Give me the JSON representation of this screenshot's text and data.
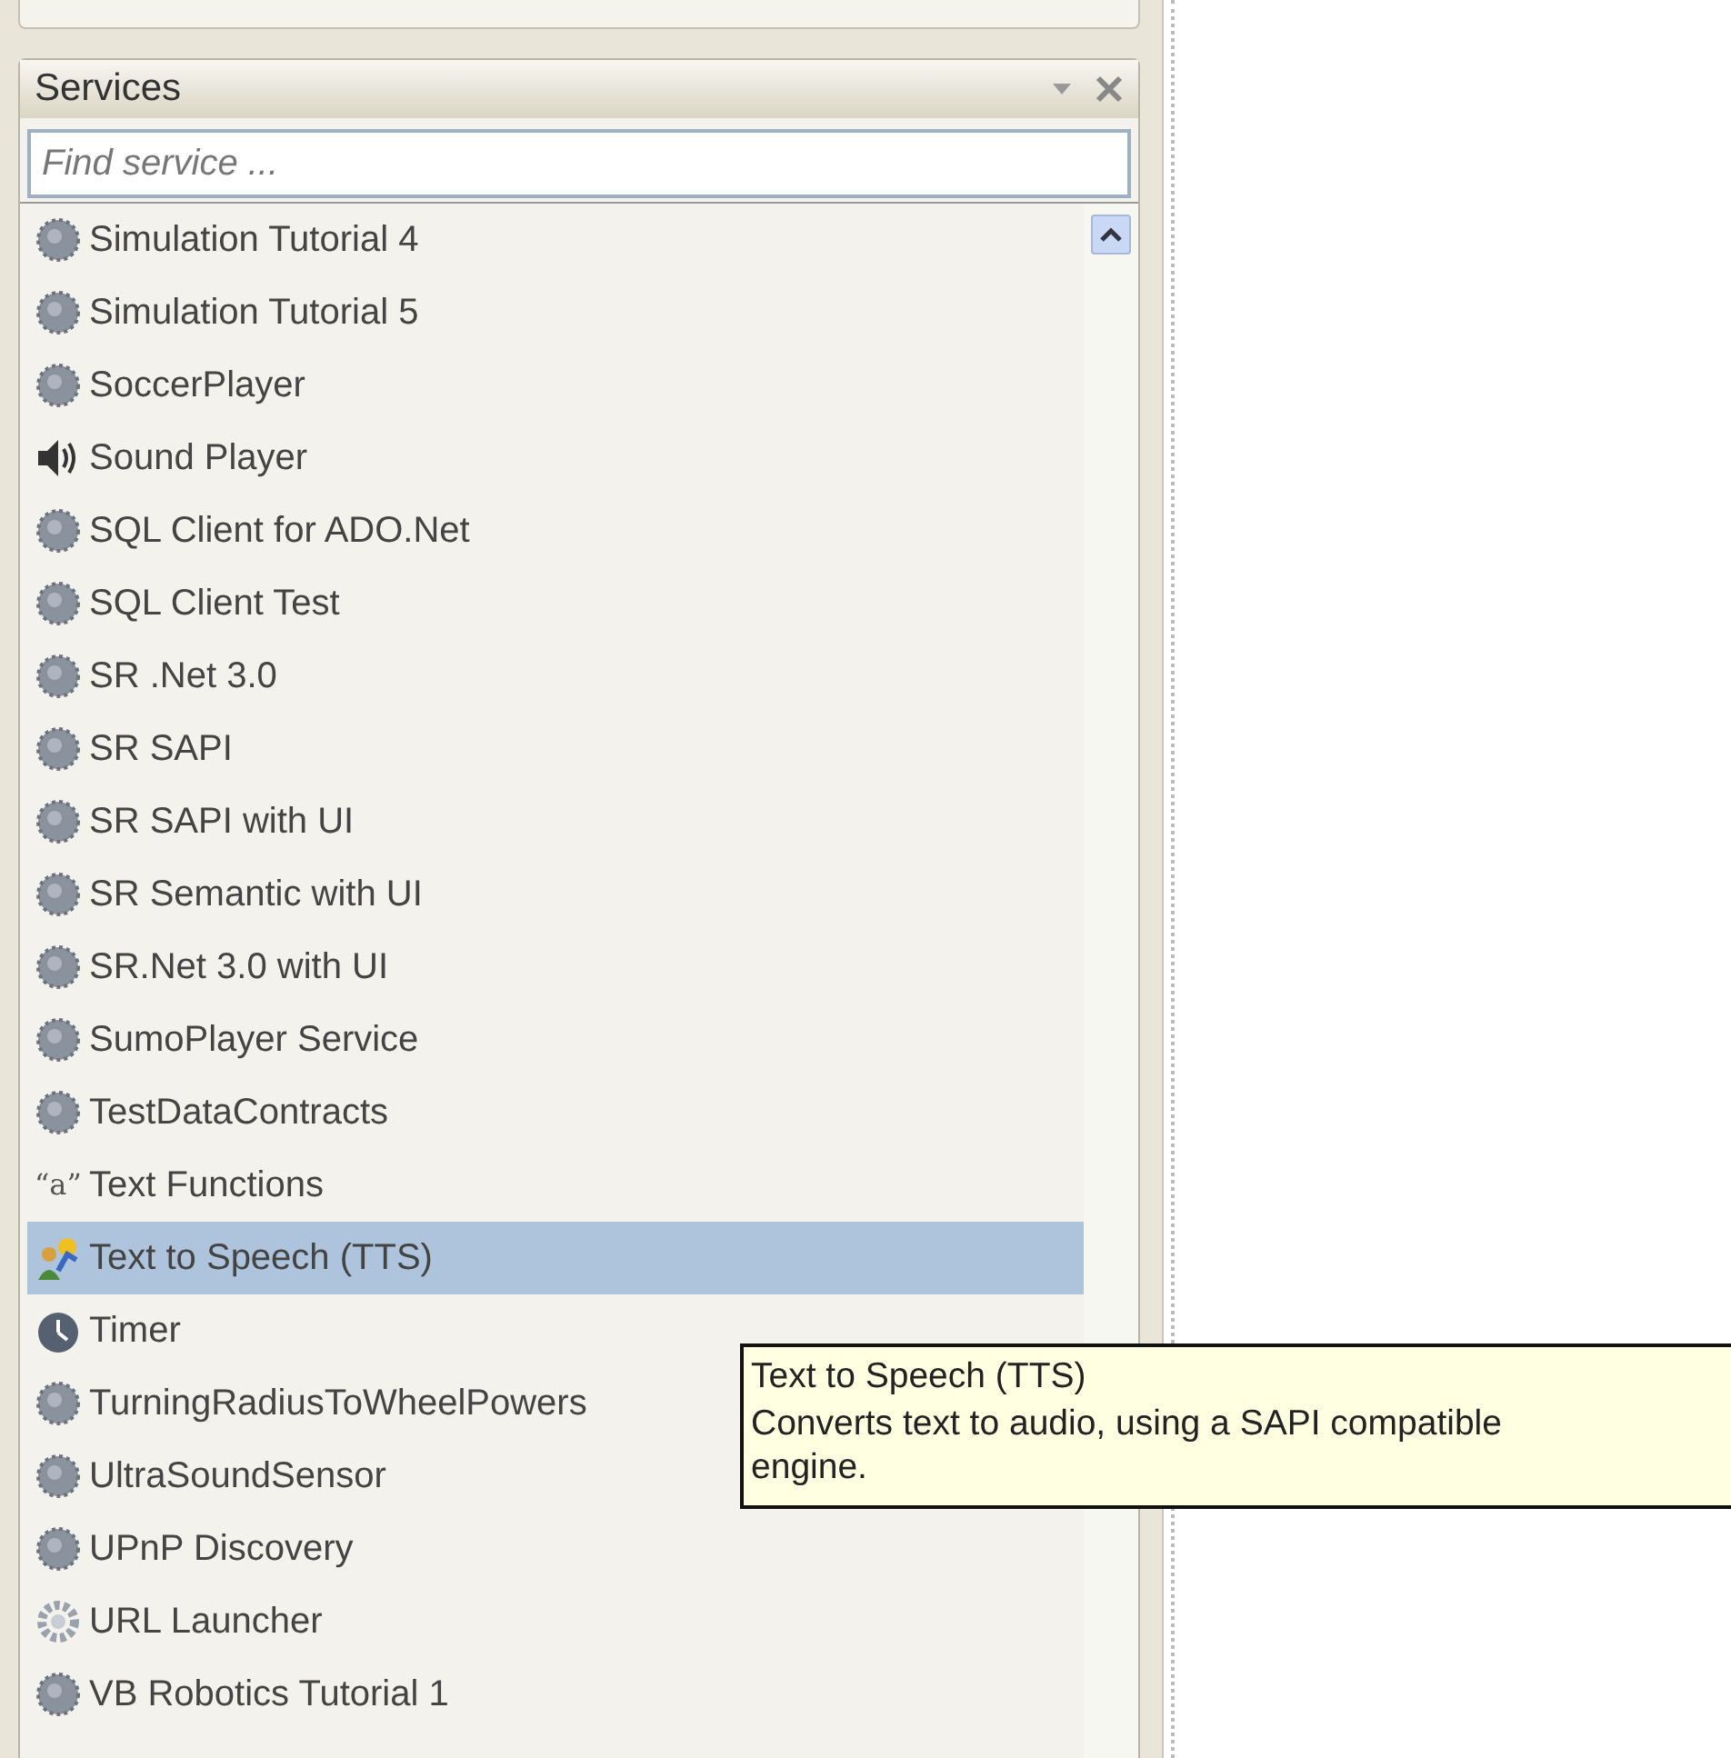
{
  "panel": {
    "title": "Services",
    "search": {
      "placeholder": "Find service ..."
    }
  },
  "services": [
    {
      "label": "Simulation Tutorial 4",
      "kind": "service",
      "selected": false
    },
    {
      "label": "Simulation Tutorial 5",
      "kind": "service",
      "selected": false
    },
    {
      "label": "SoccerPlayer",
      "kind": "service",
      "selected": false
    },
    {
      "label": "Sound Player",
      "kind": "sound",
      "selected": false
    },
    {
      "label": "SQL Client for ADO.Net",
      "kind": "service",
      "selected": false
    },
    {
      "label": "SQL Client Test",
      "kind": "service",
      "selected": false
    },
    {
      "label": "SR .Net 3.0",
      "kind": "service",
      "selected": false
    },
    {
      "label": "SR SAPI",
      "kind": "service",
      "selected": false
    },
    {
      "label": "SR SAPI with UI",
      "kind": "service",
      "selected": false
    },
    {
      "label": "SR Semantic with UI",
      "kind": "service",
      "selected": false
    },
    {
      "label": "SR.Net 3.0 with UI",
      "kind": "service",
      "selected": false
    },
    {
      "label": "SumoPlayer Service",
      "kind": "service",
      "selected": false
    },
    {
      "label": "TestDataContracts",
      "kind": "service",
      "selected": false
    },
    {
      "label": "Text Functions",
      "kind": "text",
      "icon_text": "“a”",
      "selected": false
    },
    {
      "label": "Text to Speech (TTS)",
      "kind": "tts",
      "selected": true
    },
    {
      "label": "Timer",
      "kind": "timer",
      "selected": false
    },
    {
      "label": "TurningRadiusToWheelPowers",
      "kind": "service",
      "selected": false
    },
    {
      "label": "UltraSoundSensor",
      "kind": "service",
      "selected": false
    },
    {
      "label": "UPnP Discovery",
      "kind": "service",
      "selected": false
    },
    {
      "label": "URL Launcher",
      "kind": "url",
      "selected": false
    },
    {
      "label": "VB Robotics Tutorial 1",
      "kind": "service",
      "selected": false
    }
  ],
  "tooltip": {
    "title": "Text to Speech (TTS)",
    "description": "Converts text to audio, using a SAPI compatible engine."
  }
}
